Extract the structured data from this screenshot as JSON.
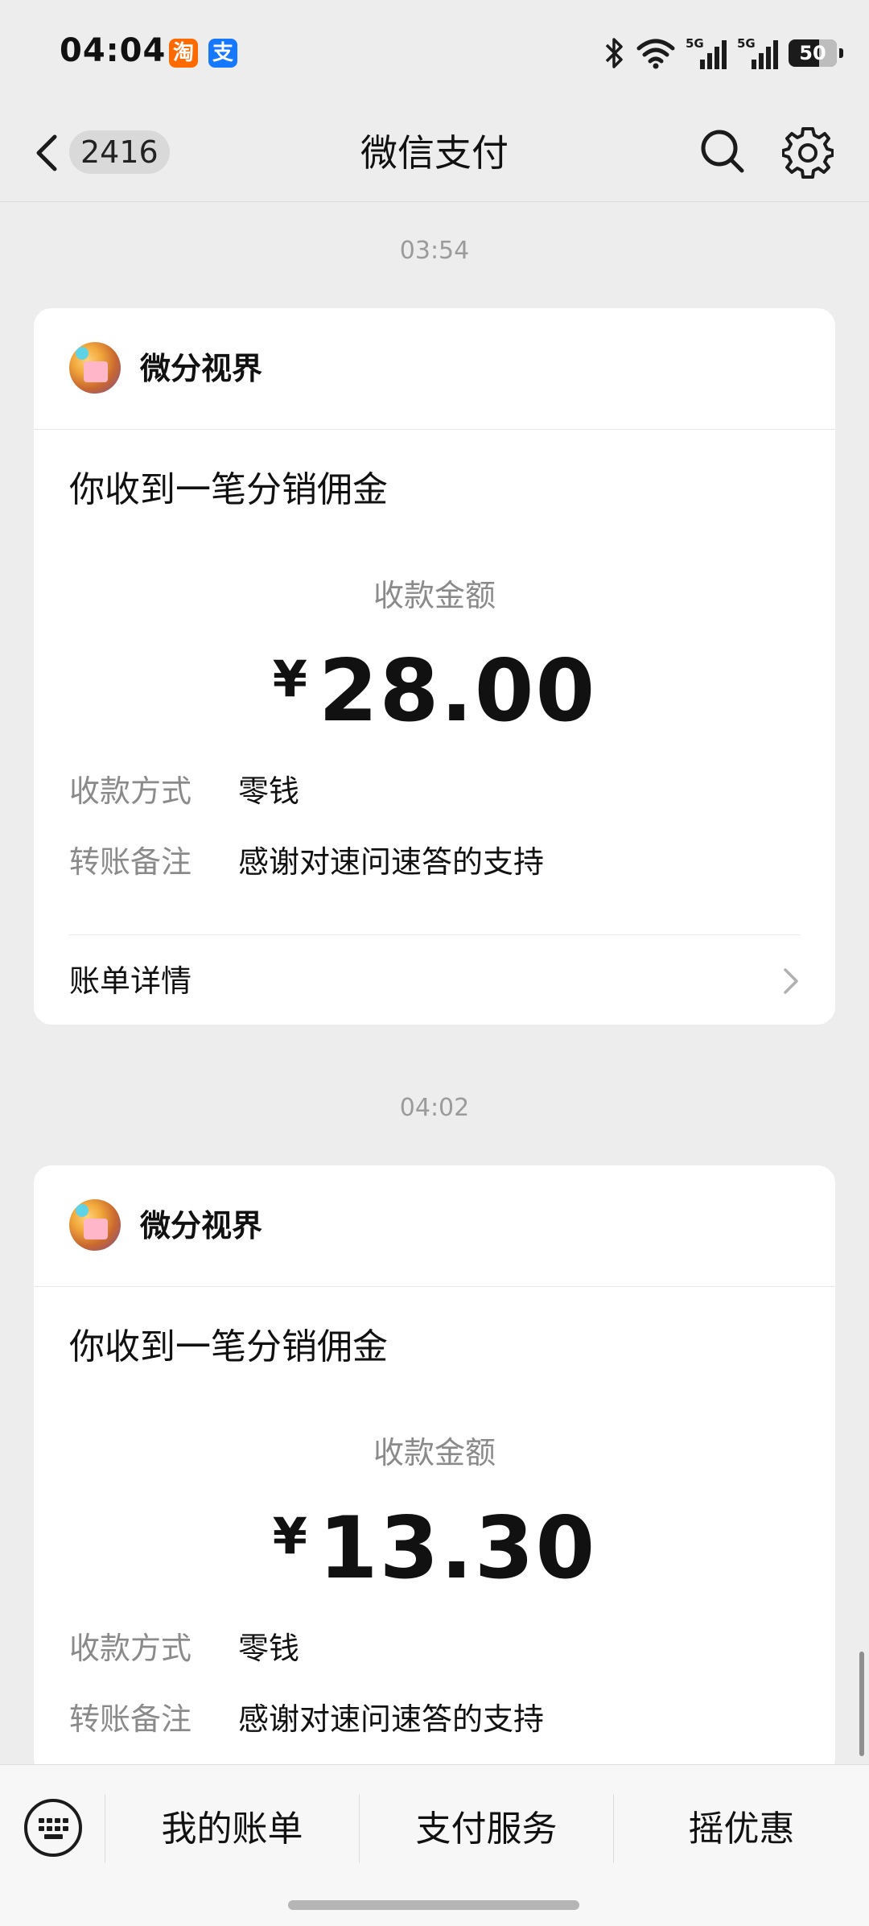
{
  "status_bar": {
    "time": "04:04",
    "apps": [
      {
        "name": "taobao-icon",
        "glyph": "淘"
      },
      {
        "name": "alipay-icon",
        "glyph": "支"
      }
    ],
    "network": [
      "5G",
      "5G"
    ],
    "battery": "50"
  },
  "nav": {
    "unread_count": "2416",
    "title": "微信支付"
  },
  "messages": [
    {
      "time": "03:54",
      "merchant": "微分视界",
      "title": "你收到一笔分销佣金",
      "amount_label": "收款金额",
      "currency": "¥",
      "amount": "28.00",
      "rows": [
        {
          "key": "收款方式",
          "value": "零钱"
        },
        {
          "key": "转账备注",
          "value": "感谢对速问速答的支持"
        }
      ],
      "detail_label": "账单详情"
    },
    {
      "time": "04:02",
      "merchant": "微分视界",
      "title": "你收到一笔分销佣金",
      "amount_label": "收款金额",
      "currency": "¥",
      "amount": "13.30",
      "rows": [
        {
          "key": "收款方式",
          "value": "零钱"
        },
        {
          "key": "转账备注",
          "value": "感谢对速问速答的支持"
        }
      ]
    }
  ],
  "bottom_menu": [
    "我的账单",
    "支付服务",
    "摇优惠"
  ]
}
